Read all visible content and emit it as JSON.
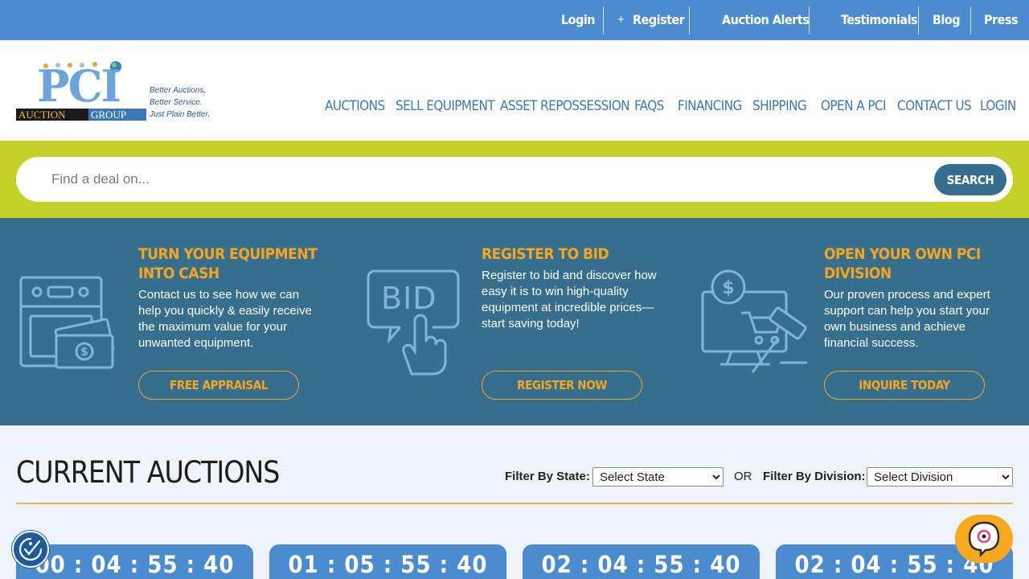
{
  "topbar": {
    "links": [
      "Login",
      "Register",
      "Auction Alerts",
      "Testimonials",
      "Blog",
      "Press"
    ],
    "register_icon": "+"
  },
  "logo": {
    "brand": "PCI",
    "sub_left": "AUCTION",
    "sub_right": "GROUP",
    "taglines": [
      "Better Auctions.",
      "Better Service.",
      "Just Plain Better."
    ]
  },
  "nav": [
    "AUCTIONS",
    "SELL EQUIPMENT",
    "ASSET REPOSSESSION",
    "FAQS",
    "FINANCING",
    "SHIPPING",
    "OPEN A PCI",
    "CONTACT US",
    "LOGIN"
  ],
  "search": {
    "placeholder": "Find a deal on...",
    "button": "SEARCH"
  },
  "promos": [
    {
      "title": "TURN YOUR EQUIPMENT INTO CASH",
      "text": "Contact us to see how we can help you quickly & easily receive the maximum value for your unwanted equipment.",
      "button": "FREE APPRAISAL",
      "icon": "equipment-cash-icon"
    },
    {
      "title": "REGISTER TO BID",
      "text": "Register to bid and discover how easy it is to win high-quality equipment at incredible prices—start saving today!",
      "button": "REGISTER NOW",
      "icon": "bid-icon",
      "icon_text": "BID"
    },
    {
      "title": "OPEN YOUR OWN PCI DIVISION",
      "text": "Our proven process and expert support can help you start your own business and achieve financial success.",
      "button": "INQUIRE TODAY",
      "icon": "online-auction-icon"
    }
  ],
  "auctions": {
    "title": "CURRENT AUCTIONS",
    "filter_state_label": "Filter By State:",
    "filter_state_value": "Select State",
    "or_label": "OR",
    "filter_division_label": "Filter By Division:",
    "filter_division_value": "Select Division",
    "countdowns": [
      "00 : 04 : 55 : 40",
      "01 : 05 : 55 : 40",
      "02 : 04 : 55 : 40",
      "02 : 04 : 55 : 40"
    ]
  },
  "colors": {
    "topbar": "#4a8ccf",
    "nav": "#3b78b6",
    "search_band": "#c4d126",
    "promo_band": "#366f8d",
    "accent_orange": "#f7a51c",
    "card": "#4a8ccf"
  },
  "widgets": {
    "accessibility_icon": "accessibility-icon",
    "chat_icon": "chat-icon"
  }
}
